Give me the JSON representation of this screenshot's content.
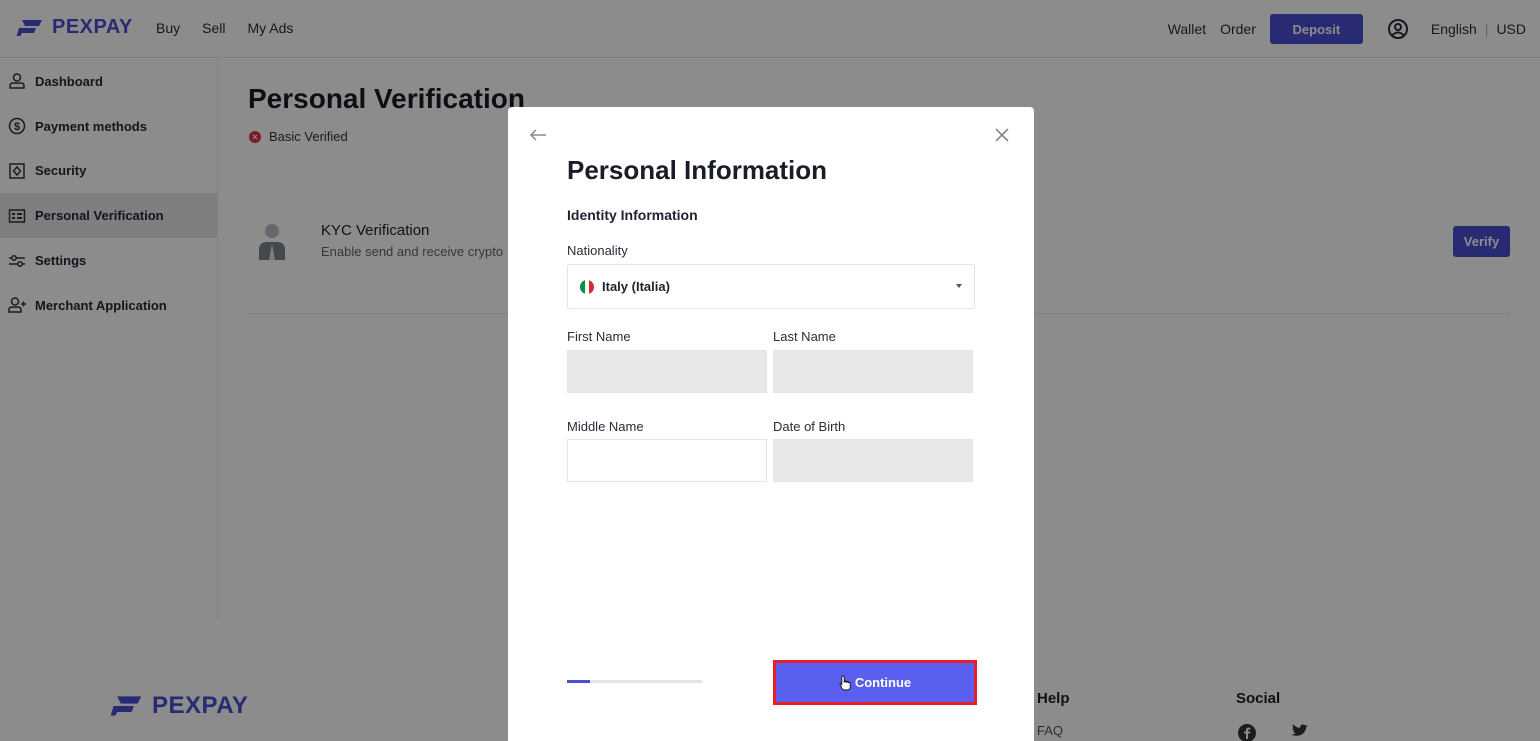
{
  "brand": {
    "name": "PEXPAY",
    "accent": "#4a4fd1"
  },
  "topnav": {
    "items": [
      "Buy",
      "Sell",
      "My Ads"
    ]
  },
  "header_right": {
    "wallet": "Wallet",
    "order": "Order",
    "deposit": "Deposit",
    "language": "English",
    "currency": "USD"
  },
  "sidebar": {
    "items": [
      {
        "label": "Dashboard",
        "icon": "user-icon"
      },
      {
        "label": "Payment methods",
        "icon": "dollar-icon"
      },
      {
        "label": "Security",
        "icon": "shield-icon"
      },
      {
        "label": "Personal Verification",
        "icon": "id-card-icon",
        "active": true
      },
      {
        "label": "Settings",
        "icon": "sliders-icon"
      },
      {
        "label": "Merchant Application",
        "icon": "user-plus-icon"
      }
    ]
  },
  "main": {
    "title": "Personal Verification",
    "status": "Basic Verified",
    "kyc": {
      "title": "KYC Verification",
      "subtitle": "Enable send and receive crypto",
      "button": "Verify"
    }
  },
  "footer": {
    "help": "Help",
    "faq": "FAQ",
    "social": "Social"
  },
  "modal": {
    "title": "Personal Information",
    "section": "Identity Information",
    "nationality_label": "Nationality",
    "nationality_value": "Italy (Italia)",
    "first_name_label": "First Name",
    "last_name_label": "Last Name",
    "middle_name_label": "Middle Name",
    "dob_label": "Date of Birth",
    "first_name_value": "",
    "last_name_value": "",
    "middle_name_value": "",
    "dob_value": "",
    "progress_fraction": 0.17,
    "continue": "Continue"
  }
}
